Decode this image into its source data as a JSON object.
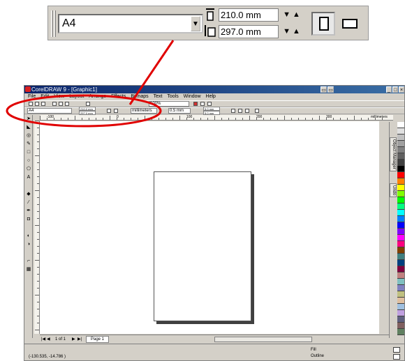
{
  "zoom_toolbar": {
    "paper_type": "A4",
    "width_value": "210.0 mm",
    "height_value": "297.0 mm",
    "spin_glyphs": "▼▲"
  },
  "app": {
    "title": "CorelDRAW 9 - [Graphic1]",
    "menu": [
      "File",
      "Edit",
      "View",
      "Layout",
      "Arrange",
      "Effects",
      "Bitmaps",
      "Text",
      "Tools",
      "Window",
      "Help"
    ],
    "toolbar": {
      "paper_type": "A4",
      "width_value": "210.0 mm",
      "height_value": "297.0 mm",
      "zoom_value": "100%",
      "units": "millimeters",
      "nudge_value": "0.5 mm",
      "dup_x": "5.0 mm",
      "dup_y": "5.0 mm"
    },
    "ruler_labels": [
      "-100",
      "0",
      "100",
      "200",
      "300"
    ],
    "ruler_unit": "millimeters",
    "dock_tabs": [
      "Object Manager",
      "Undo"
    ],
    "pagebar": {
      "page_count": "1 of 1",
      "page_tab": "Page 1"
    },
    "status": {
      "coords": "(-130.535, -14.786 )",
      "fill_label": "Fill",
      "outline_label": "Outline"
    },
    "palette_colors": [
      "#ffffff",
      "#e0e0e0",
      "#c0c0c0",
      "#a0a0a0",
      "#808080",
      "#606060",
      "#404040",
      "#000000",
      "#ff0000",
      "#ff8000",
      "#ffff00",
      "#80ff00",
      "#00ff00",
      "#00ff80",
      "#00ffff",
      "#0080ff",
      "#0000ff",
      "#8000ff",
      "#ff00ff",
      "#ff0080",
      "#804000",
      "#408080",
      "#004080",
      "#800040",
      "#c08080",
      "#80c0c0",
      "#8080c0",
      "#c0c080",
      "#e0c0a0",
      "#a0c0e0",
      "#c0a0e0",
      "#606080",
      "#806060",
      "#608060"
    ]
  }
}
